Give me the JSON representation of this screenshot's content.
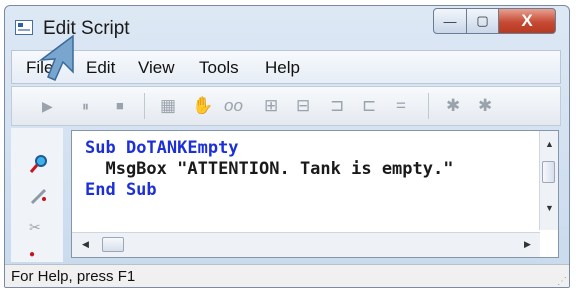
{
  "window": {
    "title": "Edit Script"
  },
  "title_controls": {
    "minimize": "—",
    "maximize": "▢",
    "close": "X"
  },
  "menu": {
    "file": "File",
    "edit": "Edit",
    "view": "View",
    "tools": "Tools",
    "help": "Help"
  },
  "toolbar": {
    "run": "▶",
    "pause": "⏸",
    "stop": "■",
    "calendar": "▦",
    "hand": "✋",
    "glasses": "oo",
    "watch1": "⊞",
    "watch2": "⊟",
    "step_into": "⊐",
    "step_over": "⊏",
    "equals": "=",
    "breakpoint": "✱",
    "clear": "✱"
  },
  "side_icons": {
    "find": "🔍",
    "pencil": "✎",
    "cut": "✂",
    "dot": "●"
  },
  "code": {
    "line1_kw": "Sub",
    "line1_name": " DoTANKEmpty",
    "line2_text": "  MsgBox ",
    "line2_str": "\"ATTENTION. Tank is empty.\"",
    "line3_kw": "End Sub"
  },
  "status": {
    "text": "For Help, press F1"
  },
  "colors": {
    "keyword": "#1c2fd8",
    "close_button": "#c64a34",
    "titlebar": "#dde8f4"
  }
}
